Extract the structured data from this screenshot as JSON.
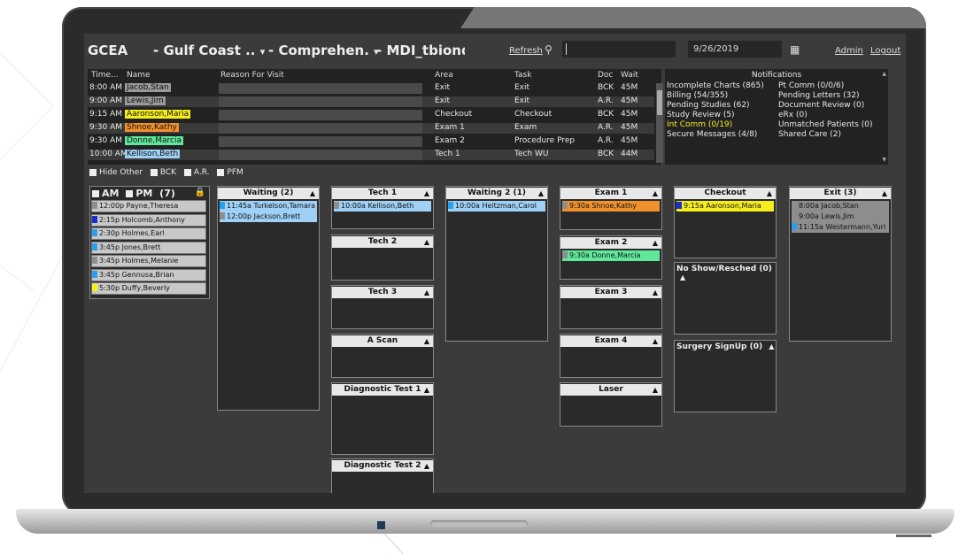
{
  "topbar": {
    "org": "GCEA",
    "location": "- Gulf Coast ..",
    "location_arrow": "▾",
    "practice": "- Comprehen.",
    "practice_arrow": "▾",
    "user": "- MDI_tbiondc",
    "refresh": "Refresh",
    "date": "9/26/2019",
    "admin": "Admin",
    "logout": "Logout"
  },
  "schedule": {
    "headers": {
      "time": "Time...",
      "name": "Name",
      "reason": "Reason For Visit",
      "area": "Area",
      "task": "Task",
      "doc": "Doc",
      "wait": "Wait"
    },
    "rows": [
      {
        "time": "8:00 AM",
        "name": "Jacob,Stan",
        "area": "Exit",
        "task": "Exit",
        "doc": "BCK",
        "wait": "45M",
        "color": "#9a9a9a"
      },
      {
        "time": "9:00 AM",
        "name": "Lewis,Jim",
        "area": "Exit",
        "task": "Exit",
        "doc": "A.R.",
        "wait": "45M",
        "color": "#9a9a9a"
      },
      {
        "time": "9:15 AM",
        "name": "Aaronson,Maria",
        "area": "Checkout",
        "task": "Checkout",
        "doc": "BCK",
        "wait": "45M",
        "color": "#f6ee1c"
      },
      {
        "time": "9:30 AM",
        "name": "Shnoe,Kathy",
        "area": "Exam 1",
        "task": "Exam",
        "doc": "A.R.",
        "wait": "45M",
        "color": "#f0912c"
      },
      {
        "time": "9:30 AM",
        "name": "Donne,Marcia",
        "area": "Exam 2",
        "task": "Procedure Prep",
        "doc": "A.R.",
        "wait": "45M",
        "color": "#5fe89a"
      },
      {
        "time": "10:00 AM",
        "name": "Kellison,Beth",
        "area": "Tech 1",
        "task": "Tech WU",
        "doc": "BCK",
        "wait": "44M",
        "color": "#9fd0f5"
      }
    ]
  },
  "notifications": {
    "title": "Notifications",
    "left": [
      {
        "text": "Incomplete Charts (865)",
        "highlight": false
      },
      {
        "text": "Billing (54/355)",
        "highlight": false
      },
      {
        "text": "Pending Studies (62)",
        "highlight": false
      },
      {
        "text": "Study Review (5)",
        "highlight": false
      },
      {
        "text": "Int Comm (0/19)",
        "highlight": true
      },
      {
        "text": "Secure Messages (4/8)",
        "highlight": false
      }
    ],
    "right": [
      "Pt Comm (0/0/6)",
      "Pending Letters (32)",
      "Document Review (0)",
      "eRx (0)",
      "Unmatched Patients (0)",
      "Shared Care (2)"
    ]
  },
  "filters": {
    "hide_other": "Hide Other",
    "bck": "BCK",
    "ar": "A.R.",
    "pfm": "PFM"
  },
  "colors": {
    "blue": "#2ba0ea",
    "gray": "#8e8e8e",
    "yellow": "#f6ee1c",
    "orange": "#f0912c",
    "green": "#5fe89a",
    "darkblue": "#1a2fd0",
    "lightblue": "#9fd0f5",
    "panelgray": "#c8c8c8"
  },
  "ampm": {
    "am": "AM",
    "pm": "PM",
    "count": "(7)",
    "lock_icon": "🔒",
    "items": [
      "12:00p Payne,Theresa",
      "2:15p Holcomb,Anthony",
      "2:30p Holmes,Earl",
      "3:45p Jones,Brett",
      "3:45p Holmes,Melanie",
      "3:45p Gennusa,Brian",
      "5:30p Duffy,Beverly"
    ]
  },
  "waiting": {
    "title": "Waiting (2)",
    "items": [
      "11:45a Turkelson,Tamara",
      "12:00p Jackson,Brett"
    ]
  },
  "tech1": {
    "title": "Tech 1",
    "items": [
      "10:00a Kellison,Beth"
    ]
  },
  "tech2": {
    "title": "Tech 2"
  },
  "tech3": {
    "title": "Tech 3"
  },
  "ascan": {
    "title": "A Scan"
  },
  "diag1": {
    "title": "Diagnostic Test 1"
  },
  "diag2": {
    "title": "Diagnostic Test 2"
  },
  "waiting2": {
    "title": "Waiting 2 (1)",
    "items": [
      "10:00a Heitzman,Carol"
    ]
  },
  "exam1": {
    "title": "Exam 1",
    "items": [
      "9:30a Shnoe,Kathy"
    ]
  },
  "exam2": {
    "title": "Exam 2",
    "items": [
      "9:30a Donne,Marcia"
    ]
  },
  "exam3": {
    "title": "Exam 3"
  },
  "exam4": {
    "title": "Exam 4"
  },
  "laser": {
    "title": "Laser"
  },
  "checkout": {
    "title": "Checkout",
    "items": [
      "9:15a Aaronson,Maria"
    ]
  },
  "noshow": {
    "title": "No Show/Resched (0)"
  },
  "surgery": {
    "title": "Surgery SignUp (0)"
  },
  "exit": {
    "title": "Exit (3)",
    "items": [
      "8:00a Jacob,Stan",
      "9:00a Lewis,Jim",
      "11:15a Westermann,Yuri"
    ]
  },
  "arrow": "▲"
}
